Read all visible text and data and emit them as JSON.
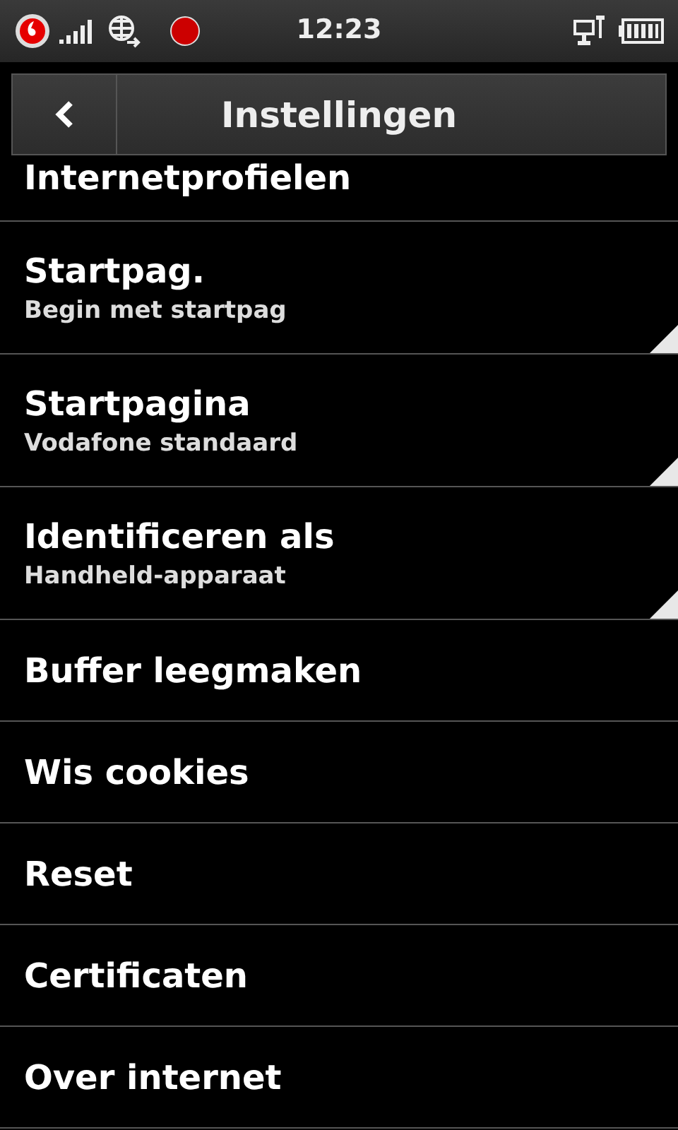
{
  "status_bar": {
    "time": "12:23"
  },
  "header": {
    "title": "Instellingen"
  },
  "items": [
    {
      "kind": "partial",
      "label": "Internetprofielen"
    },
    {
      "kind": "option",
      "label": "Startpag.",
      "value": "Begin met startpag"
    },
    {
      "kind": "option",
      "label": "Startpagina",
      "value": "Vodafone standaard"
    },
    {
      "kind": "option",
      "label": "Identificeren als",
      "value": "Handheld-apparaat"
    },
    {
      "kind": "action",
      "label": "Buffer leegmaken"
    },
    {
      "kind": "action",
      "label": "Wis cookies"
    },
    {
      "kind": "action",
      "label": "Reset"
    },
    {
      "kind": "action",
      "label": "Certificaten"
    },
    {
      "kind": "action",
      "label": "Over internet"
    }
  ]
}
